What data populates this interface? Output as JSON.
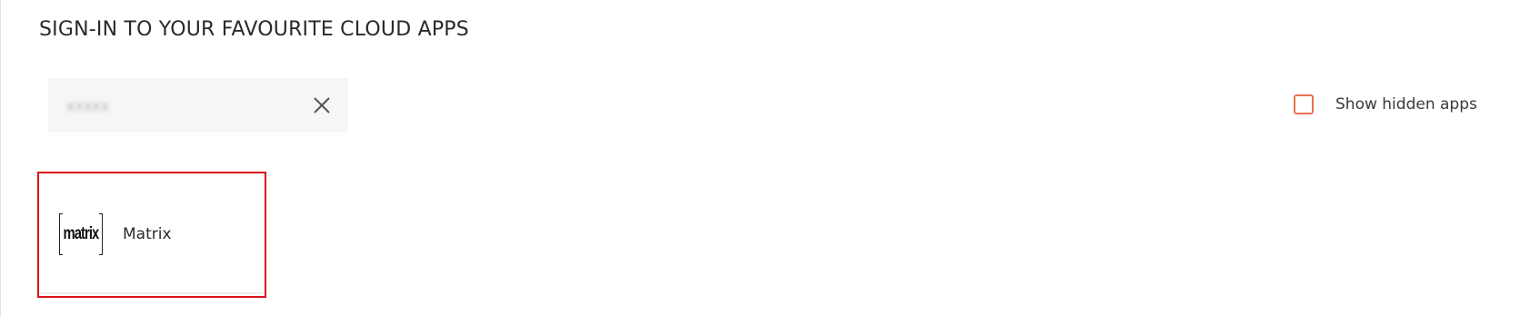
{
  "header": {
    "title": "SIGN-IN TO YOUR FAVOURITE CLOUD APPS"
  },
  "search": {
    "value": "xxxxx",
    "clear_icon": "close-icon"
  },
  "filters": {
    "show_hidden_label": "Show hidden apps",
    "show_hidden_checked": false,
    "checkbox_color": "#e8714f"
  },
  "apps": [
    {
      "name": "Matrix",
      "logo_text": "matrix",
      "logo_icon": "matrix-logo-icon",
      "highlight_color": "#d9121b"
    }
  ]
}
